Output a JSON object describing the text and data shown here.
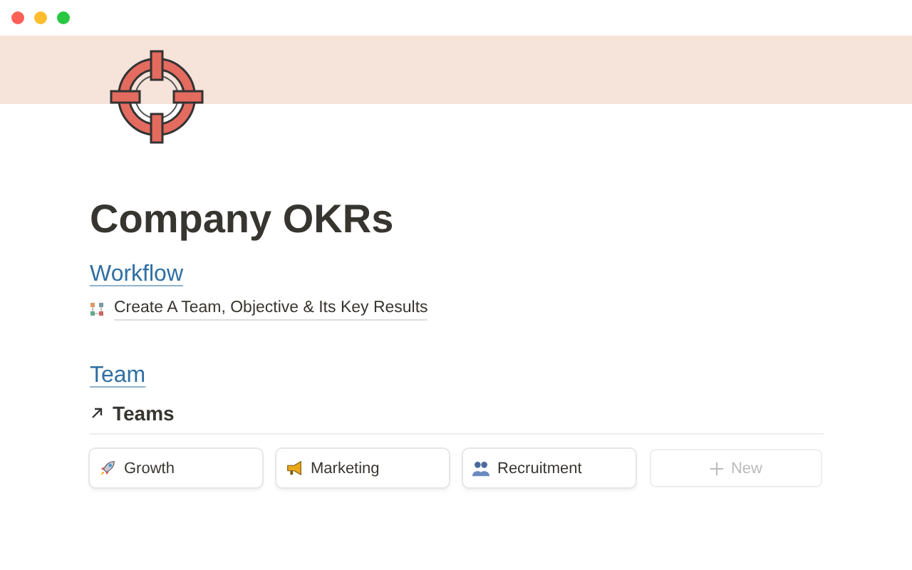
{
  "title": "Company OKRs",
  "sections": [
    {
      "heading": "Workflow",
      "link": "Create A Team, Objective & Its Key Results"
    },
    {
      "heading": "Team",
      "view_title": "Teams",
      "cards": [
        {
          "label": "Growth"
        },
        {
          "label": "Marketing"
        },
        {
          "label": "Recruitment"
        }
      ],
      "new_label": "New"
    }
  ]
}
